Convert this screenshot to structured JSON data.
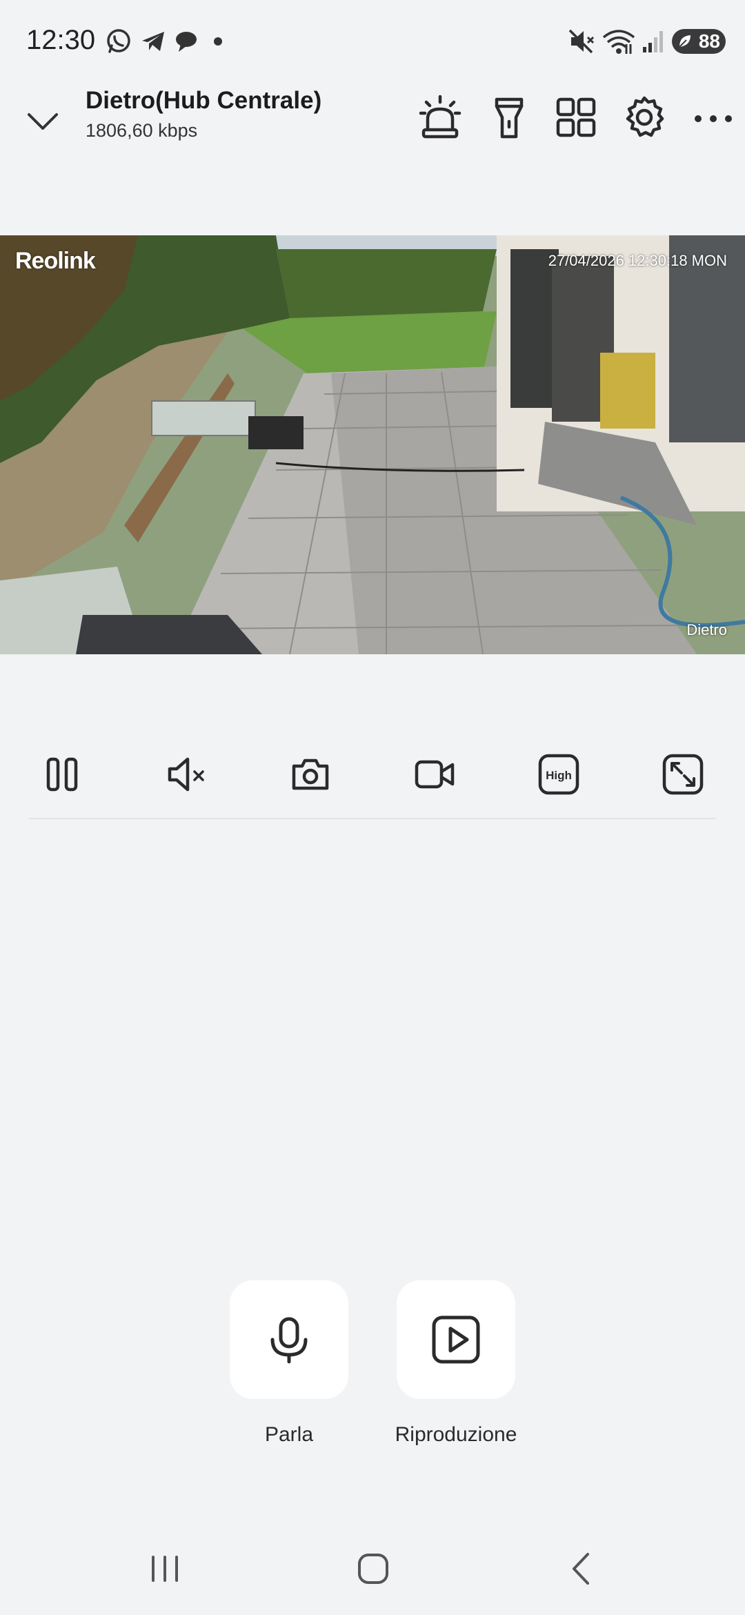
{
  "status_bar": {
    "time": "12:30",
    "notification_icons": [
      "whatsapp-icon",
      "telegram-icon",
      "chat-bubble-icon",
      "dot-icon"
    ],
    "system_icons": [
      "mute-icon",
      "wifi-icon",
      "signal-icon"
    ],
    "battery": "88"
  },
  "header": {
    "title": "Dietro(Hub Centrale)",
    "bitrate": "1806,60 kbps",
    "actions": [
      "siren-icon",
      "spotlight-icon",
      "grid-icon",
      "settings-icon",
      "more-icon"
    ]
  },
  "video": {
    "logo": "Reolink",
    "timestamp": "27/04/2026 12:30:18 MON",
    "camera_label": "Dietro"
  },
  "controls": [
    "pause-icon",
    "mute-icon",
    "snapshot-icon",
    "record-icon",
    "quality-icon",
    "fullscreen-icon"
  ],
  "quality_label": "High",
  "actions": {
    "talk_label": "Parla",
    "playback_label": "Riproduzione"
  },
  "colors": {
    "background": "#f2f3f5",
    "card": "#ffffff",
    "icon": "#2b2b2b"
  }
}
